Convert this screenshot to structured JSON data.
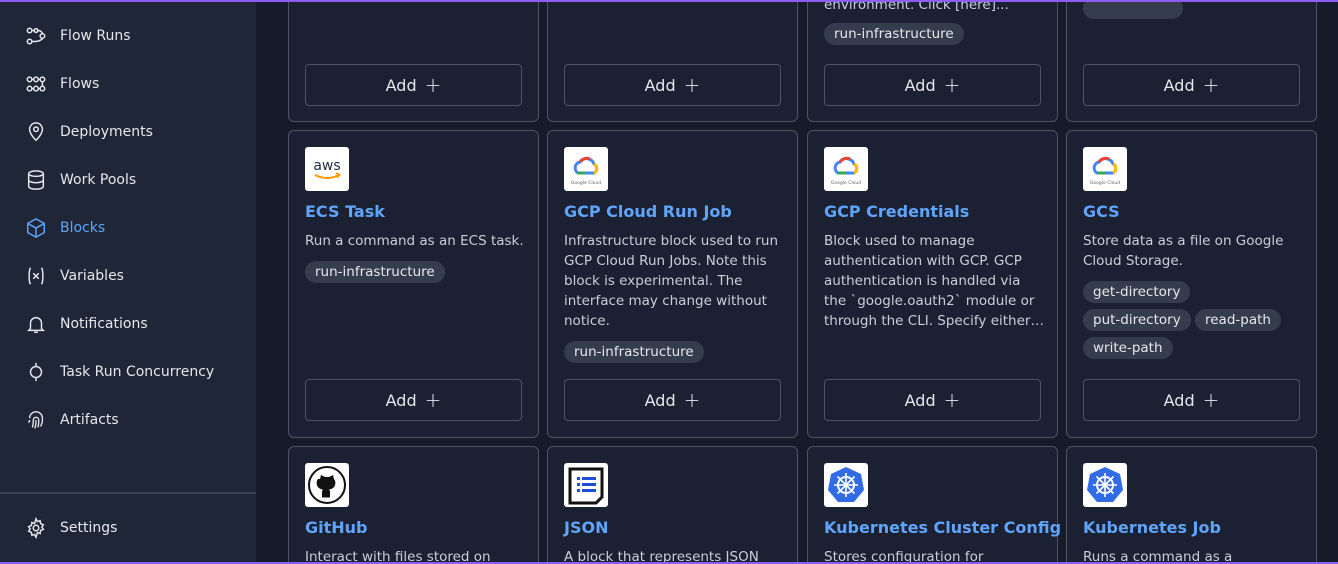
{
  "sidebar": {
    "items": [
      {
        "label": "Flow Runs",
        "icon": "flow-runs-icon"
      },
      {
        "label": "Flows",
        "icon": "flows-icon"
      },
      {
        "label": "Deployments",
        "icon": "location-pin-icon"
      },
      {
        "label": "Work Pools",
        "icon": "database-icon"
      },
      {
        "label": "Blocks",
        "icon": "cube-icon",
        "active": true
      },
      {
        "label": "Variables",
        "icon": "variable-icon"
      },
      {
        "label": "Notifications",
        "icon": "bell-icon"
      },
      {
        "label": "Task Run Concurrency",
        "icon": "concurrency-icon"
      },
      {
        "label": "Artifacts",
        "icon": "fingerprint-icon"
      }
    ],
    "settings_label": "Settings"
  },
  "add_label": "Add",
  "top_row": {
    "partial_desc": "environment. Click [here]...",
    "tag": "run-infrastructure"
  },
  "cards_row2": [
    {
      "title": "ECS Task",
      "description": "Run a command as an ECS task.",
      "logo": "aws-logo",
      "tags": [
        "run-infrastructure"
      ]
    },
    {
      "title": "GCP Cloud Run Job",
      "description": "Infrastructure block used to run GCP Cloud Run Jobs. Note this block is experimental. The interface may change without notice.",
      "logo": "google-cloud-logo",
      "tags": [
        "run-infrastructure"
      ]
    },
    {
      "title": "GCP Credentials",
      "description": "Block used to manage authentication with GCP. GCP authentication is handled via the `google.oauth2` module or through the CLI. Specify either…",
      "logo": "google-cloud-logo",
      "tags": []
    },
    {
      "title": "GCS",
      "description": "Store data as a file on Google Cloud Storage.",
      "logo": "google-cloud-logo",
      "tags": [
        "get-directory",
        "put-directory",
        "read-path",
        "write-path"
      ]
    }
  ],
  "cards_row3": [
    {
      "title": "GitHub",
      "description": "Interact with files stored on",
      "logo": "github-logo"
    },
    {
      "title": "JSON",
      "description": "A block that represents JSON",
      "logo": "json-logo"
    },
    {
      "title": "Kubernetes Cluster Config",
      "description": "Stores configuration for",
      "logo": "kubernetes-logo"
    },
    {
      "title": "Kubernetes Job",
      "description": "Runs a command as a",
      "logo": "kubernetes-logo"
    }
  ],
  "google_cloud_caption": "Google Cloud",
  "aws_caption": "aws"
}
